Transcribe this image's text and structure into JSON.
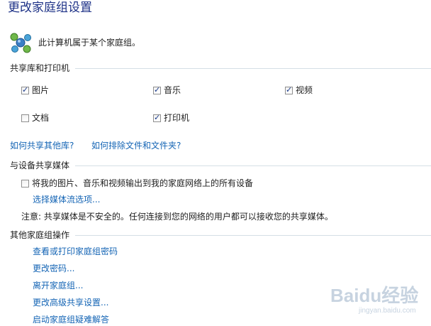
{
  "title": "更改家庭组设置",
  "homegroup": {
    "icon": "homegroup-icon",
    "status": "此计算机属于某个家庭组。"
  },
  "libraries": {
    "header": "共享库和打印机",
    "items": [
      {
        "label": "图片",
        "checked": true
      },
      {
        "label": "音乐",
        "checked": true
      },
      {
        "label": "视频",
        "checked": true
      },
      {
        "label": "文档",
        "checked": false
      },
      {
        "label": "打印机",
        "checked": true
      }
    ],
    "links": [
      "如何共享其他库?",
      "如何排除文件和文件夹?"
    ]
  },
  "media": {
    "header": "与设备共享媒体",
    "stream_label": "将我的图片、音乐和视频输出到我的家庭网络上的所有设备",
    "stream_checked": false,
    "options_link": "选择媒体流选项...",
    "note": "注意: 共享媒体是不安全的。任何连接到您的网络的用户都可以接收您的共享媒体。"
  },
  "other": {
    "header": "其他家庭组操作",
    "links": [
      "查看或打印家庭组密码",
      "更改密码...",
      "离开家庭组...",
      "更改高级共享设置...",
      "启动家庭组疑难解答"
    ]
  },
  "watermark": {
    "text": "Baidu经验",
    "sub": "jingyan.baidu.com"
  },
  "check_glyph": "✓"
}
